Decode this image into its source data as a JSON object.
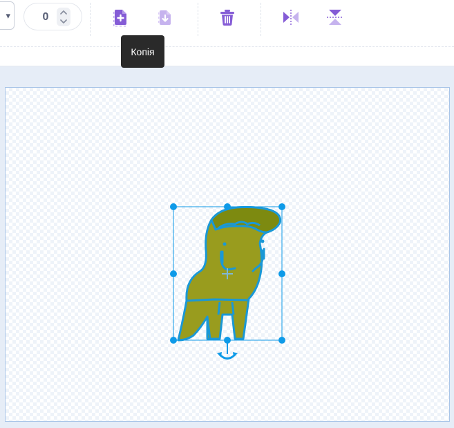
{
  "toolbar": {
    "dropdown": {
      "icon": "caret-down-icon",
      "glyph": "▾"
    },
    "stepper": {
      "value": "0"
    },
    "buttons": [
      {
        "name": "copy-button",
        "icon": "copy-icon"
      },
      {
        "name": "paste-button",
        "icon": "paste-icon"
      },
      {
        "name": "delete-button",
        "icon": "trash-icon"
      },
      {
        "name": "flip-horizontal-button",
        "icon": "flip-horizontal-icon"
      },
      {
        "name": "flip-vertical-button",
        "icon": "flip-vertical-icon"
      }
    ],
    "tooltip": "Копія"
  },
  "colors": {
    "accent": "#855cd6",
    "accent_light": "#c6b3ee",
    "selection": "#0e9ae8",
    "sprite_fill": "#999c1e",
    "sprite_dark": "#7d8a10",
    "sprite_outline": "#1a98d6"
  },
  "canvas": {
    "sprite": {
      "name": "dinosaur",
      "selected": true
    }
  }
}
